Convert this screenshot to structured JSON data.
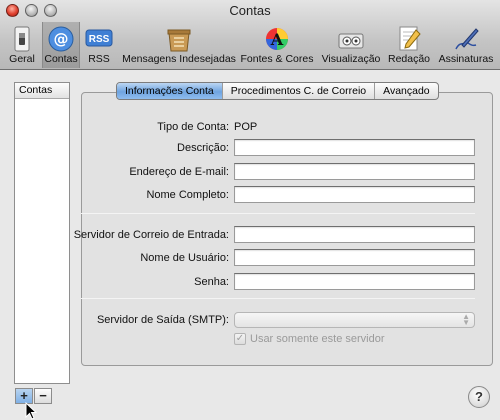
{
  "window": {
    "title": "Contas"
  },
  "toolbar": {
    "items": [
      {
        "label": "Geral",
        "icon": "light-switch-icon"
      },
      {
        "label": "Contas",
        "icon": "at-sign-icon"
      },
      {
        "label": "RSS",
        "icon": "rss-icon"
      },
      {
        "label": "Mensagens Indesejadas",
        "icon": "junk-mail-icon"
      },
      {
        "label": "Fontes & Cores",
        "icon": "fonts-colors-icon"
      },
      {
        "label": "Visualização",
        "icon": "viewing-icon"
      },
      {
        "label": "Redação",
        "icon": "composing-icon"
      },
      {
        "label": "Assinaturas",
        "icon": "signatures-icon"
      }
    ],
    "selected": "Contas"
  },
  "accounts": {
    "header": "Contas"
  },
  "tabs": [
    {
      "label": "Informações Conta",
      "selected": true
    },
    {
      "label": "Procedimentos C. de Correio",
      "selected": false
    },
    {
      "label": "Avançado",
      "selected": false
    }
  ],
  "form": {
    "account_type_label": "Tipo de Conta:",
    "account_type_value": "POP",
    "description_label": "Descrição:",
    "description_value": "",
    "email_label": "Endereço de E-mail:",
    "email_value": "",
    "fullname_label": "Nome Completo:",
    "fullname_value": "",
    "incoming_server_label": "Servidor de Correio de Entrada:",
    "incoming_server_value": "",
    "username_label": "Nome de Usuário:",
    "username_value": "",
    "password_label": "Senha:",
    "password_value": "",
    "smtp_label": "Servidor de Saída (SMTP):",
    "smtp_value": "",
    "only_this_server_label": "Usar somente este servidor",
    "only_this_server_checked": true
  },
  "buttons": {
    "add": "+",
    "remove": "−",
    "help": "?"
  },
  "colors": {
    "selected_tab": "#6fa4e0",
    "close_button": "#e0412f"
  }
}
